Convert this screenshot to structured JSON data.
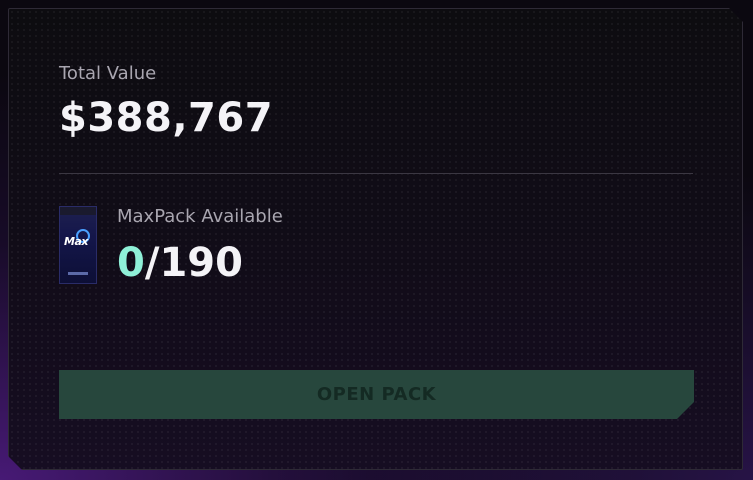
{
  "summary": {
    "total_value_label": "Total Value",
    "total_value": "$388,767"
  },
  "pack": {
    "available_label": "MaxPack Available",
    "available_count": "0",
    "separator": "/",
    "total_count": "190",
    "image_logo_text": "Max"
  },
  "actions": {
    "open_pack_label": "OPEN PACK",
    "open_pack_enabled": false
  },
  "colors": {
    "available_count": "#8ff0d8",
    "button_bg": "#27473d",
    "button_text": "#142a23"
  }
}
